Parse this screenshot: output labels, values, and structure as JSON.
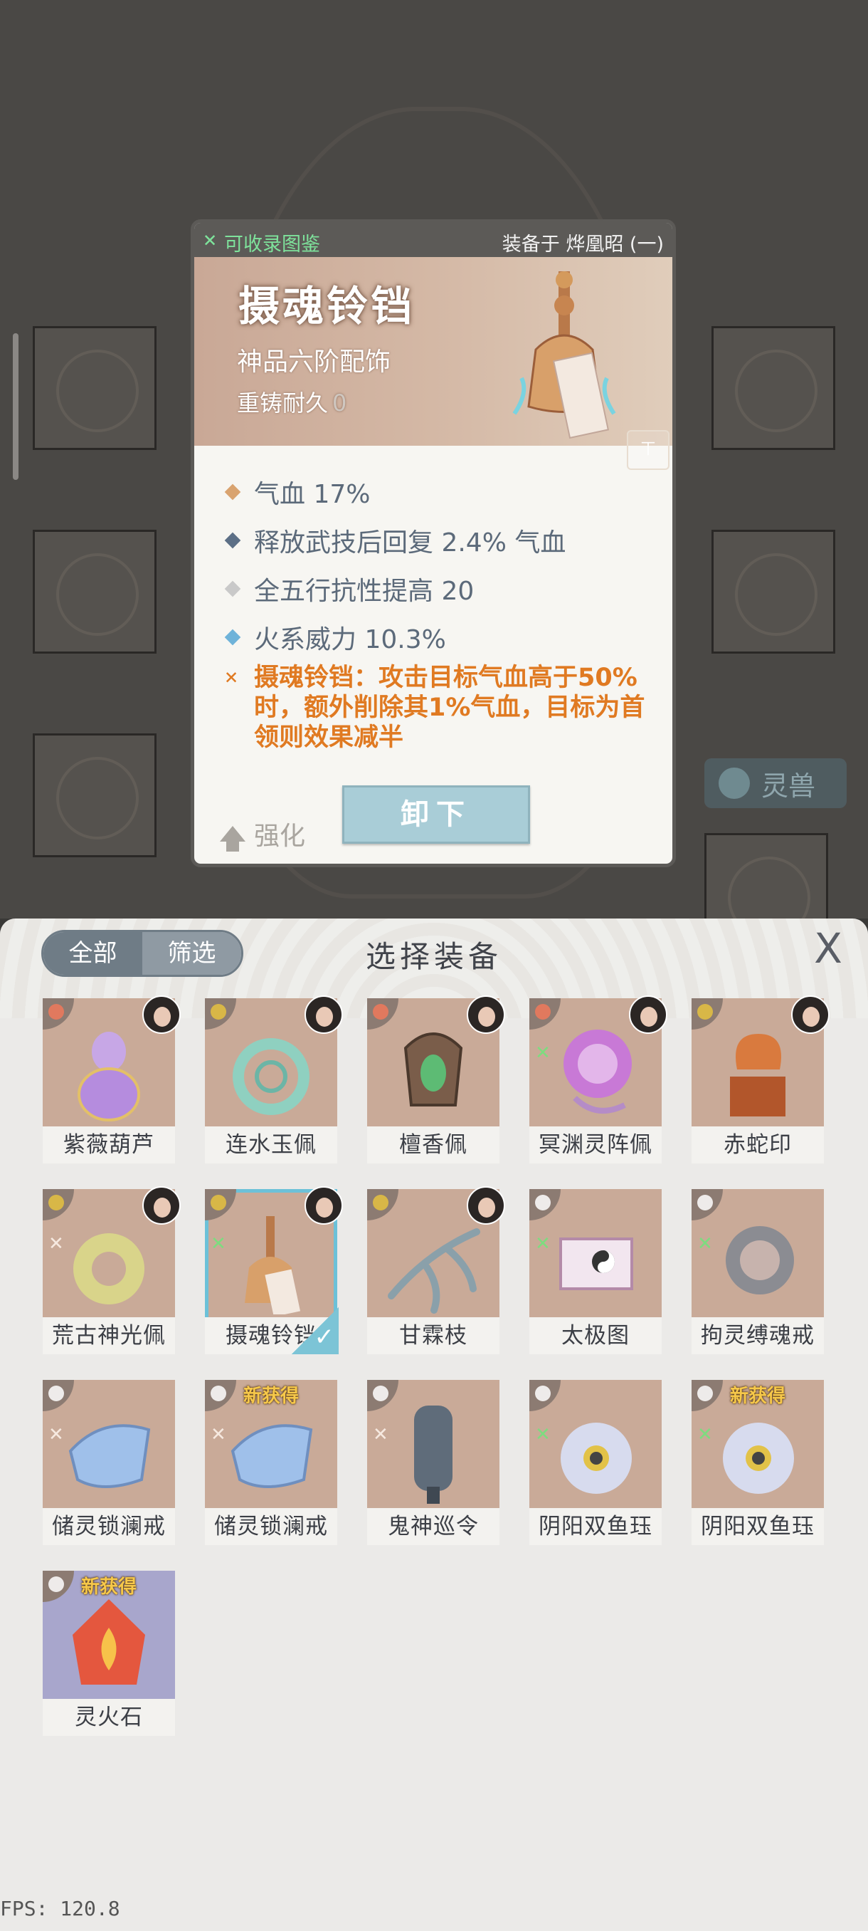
{
  "tooltip": {
    "collectible_label": "可收录图鉴",
    "equipped_label": "装备于 烨凰昭 (一)",
    "item_name": "摄魂铃铛",
    "rank": "神品六阶配饰",
    "durability_label": "重铸耐久",
    "durability_value": "0",
    "stats": [
      {
        "text": "气血 17%",
        "color": "#d9a36f"
      },
      {
        "text": "释放武技后回复 2.4% 气血",
        "color": "#5c6f86"
      },
      {
        "text": "全五行抗性提高 20",
        "color": "#c9c9c9"
      },
      {
        "text": "火系威力 10.3%",
        "color": "#6fb3d9"
      }
    ],
    "special_text": "摄魂铃铛：攻击目标气血高于50%时，额外削除其1%气血，目标为首领则效果减半",
    "enhance_label": "强化",
    "unequip_label": "卸下"
  },
  "background": {
    "tab_label": "灵兽"
  },
  "panel": {
    "title": "选择装备",
    "filter_all": "全部",
    "filter_select": "筛选",
    "close_symbol": "X",
    "new_tag": "新获得",
    "items": [
      {
        "name": "紫薇葫芦",
        "elem": "red"
      },
      {
        "name": "连水玉佩",
        "elem": "yel"
      },
      {
        "name": "檀香佩",
        "elem": "red"
      },
      {
        "name": "冥渊灵阵佩",
        "elem": "red"
      },
      {
        "name": "赤蛇印",
        "elem": "yel"
      },
      {
        "name": "荒古神光佩",
        "elem": "yel"
      },
      {
        "name": "摄魂铃铛",
        "elem": "yel"
      },
      {
        "name": "甘霖枝",
        "elem": "yel"
      },
      {
        "name": "太极图",
        "elem": "wht"
      },
      {
        "name": "拘灵缚魂戒",
        "elem": "wht"
      },
      {
        "name": "储灵锁澜戒",
        "elem": "wht"
      },
      {
        "name": "储灵锁澜戒",
        "elem": "wht"
      },
      {
        "name": "鬼神巡令",
        "elem": "wht"
      },
      {
        "name": "阴阳双鱼珏",
        "elem": "wht"
      },
      {
        "name": "阴阳双鱼珏",
        "elem": "wht"
      },
      {
        "name": "灵火石",
        "elem": "wht"
      }
    ]
  },
  "fps": "FPS: 120.8"
}
